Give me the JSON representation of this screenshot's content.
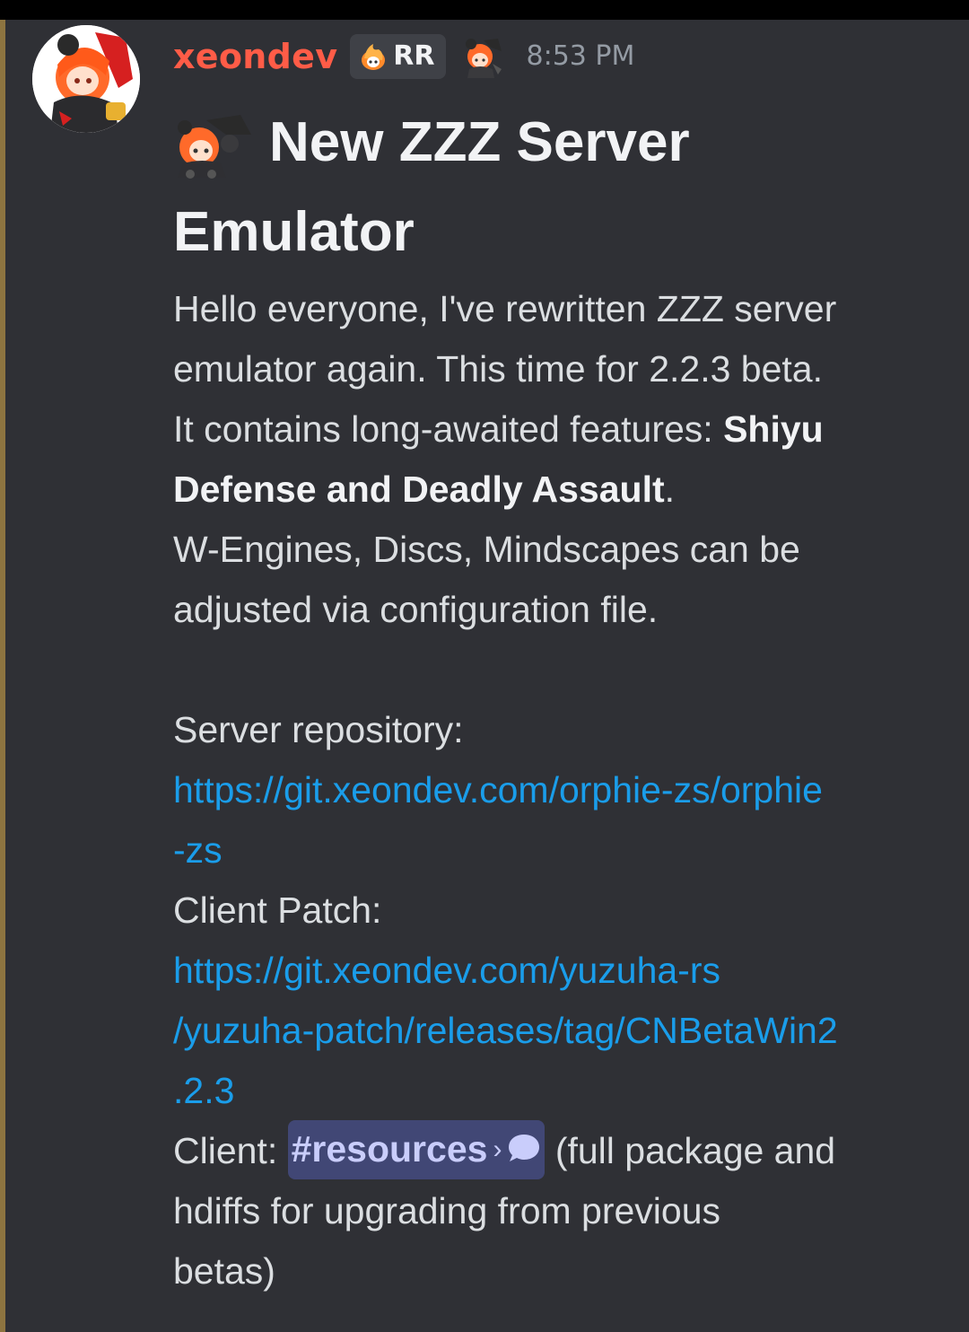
{
  "message": {
    "author": "xeondev",
    "role_tag": "RR",
    "timestamp": "8:53 PM",
    "heading_line1": "New ZZZ Server",
    "heading_line2": "Emulator",
    "lines": [
      "Hello everyone, I've rewritten ZZZ server",
      "emulator again. This time for 2.2.3 beta.",
      "It contains long-awaited features: ",
      "Shiyu",
      "Defense and Deadly Assault",
      ".",
      "W-Engines, Discs, Mindscapes can be",
      "adjusted via configuration file.",
      "Server repository:",
      "Client Patch:",
      "Client: ",
      " (full package and",
      "hdiffs for upgrading from previous",
      "betas)"
    ],
    "server_link_line1": "https://git.xeondev.com/orphie-zs/orphie",
    "server_link_line2": "-zs",
    "patch_link_line1": "https://git.xeondev.com/yuzuha-rs",
    "patch_link_line2": "/yuzuha-patch/releases/tag/CNBetaWin2",
    "patch_link_line3": ".2.3",
    "channel_mention": "#resources",
    "channel_chevron": "›"
  },
  "colors": {
    "username": "#ff5c47",
    "link": "#1a9dea",
    "mention_bg": "#414775",
    "mention_text": "#c9cdfb",
    "background": "#2f3035"
  },
  "icons": {
    "avatar": "avatar-image",
    "tag_icon": "flame-badge-icon",
    "deco": "character-sticker-icon",
    "heading": "character-emoji-icon",
    "thread": "chat-bubble-icon"
  }
}
